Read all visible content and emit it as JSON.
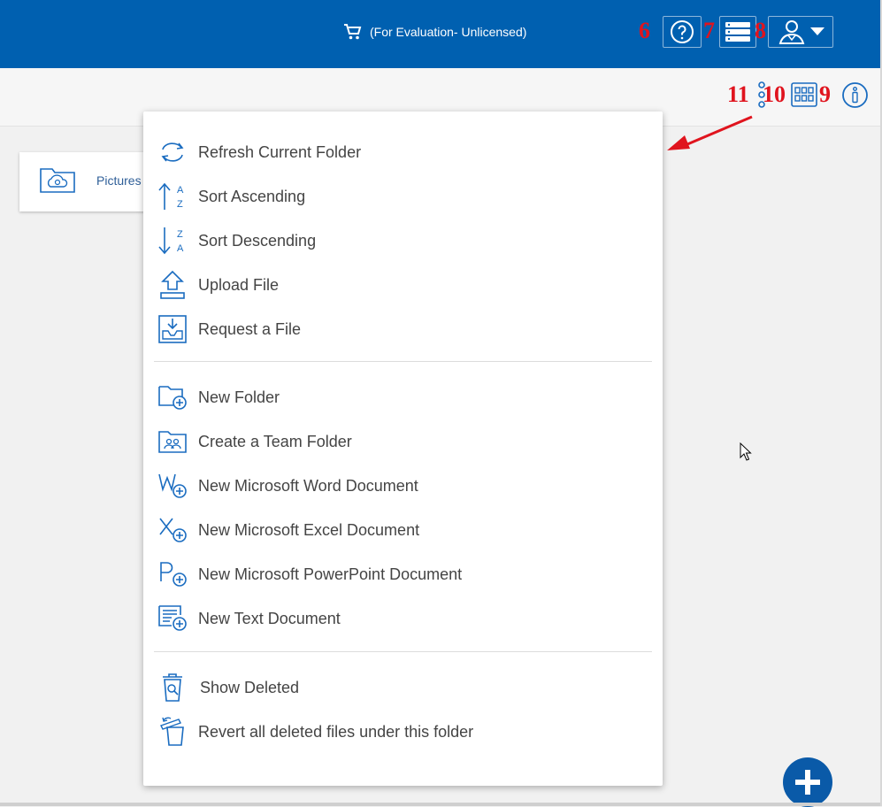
{
  "header": {
    "cart_icon": "cart-icon",
    "evaluation_text": "(For Evaluation- Unlicensed)",
    "help_icon": "help-circle-icon",
    "storage_icon": "server-stack-icon",
    "user_icon": "user-icon",
    "dropdown_icon": "caret-down-icon",
    "colors": {
      "bar": "#0060b0",
      "annotation": "#e0141e"
    }
  },
  "annotations": {
    "n6": "6",
    "n7": "7",
    "n8": "8",
    "n9": "9",
    "n10": "10",
    "n11": "11"
  },
  "toolbar": {
    "more_icon": "vertical-dots-icon",
    "grid_icon": "grid-view-icon",
    "info_icon": "info-icon"
  },
  "folder_card": {
    "label": "Pictures",
    "icon": "cloud-folder-icon"
  },
  "context_menu": {
    "groups": [
      [
        {
          "label": "Refresh Current Folder",
          "icon": "refresh-icon"
        },
        {
          "label": "Sort Ascending",
          "icon": "sort-ascending-icon"
        },
        {
          "label": "Sort Descending",
          "icon": "sort-descending-icon"
        },
        {
          "label": "Upload File",
          "icon": "upload-icon"
        },
        {
          "label": "Request a File",
          "icon": "request-file-icon"
        }
      ],
      [
        {
          "label": "New Folder",
          "icon": "new-folder-icon"
        },
        {
          "label": "Create a Team Folder",
          "icon": "team-folder-icon"
        },
        {
          "label": "New Microsoft Word Document",
          "icon": "word-add-icon"
        },
        {
          "label": "New Microsoft Excel Document",
          "icon": "excel-add-icon"
        },
        {
          "label": "New Microsoft PowerPoint Document",
          "icon": "powerpoint-add-icon"
        },
        {
          "label": "New Text Document",
          "icon": "text-document-add-icon"
        }
      ],
      [
        {
          "label": "Show Deleted",
          "icon": "show-deleted-icon"
        },
        {
          "label": "Revert all deleted files under this folder",
          "icon": "revert-deleted-icon"
        }
      ]
    ]
  },
  "fab": {
    "icon": "plus-icon"
  }
}
